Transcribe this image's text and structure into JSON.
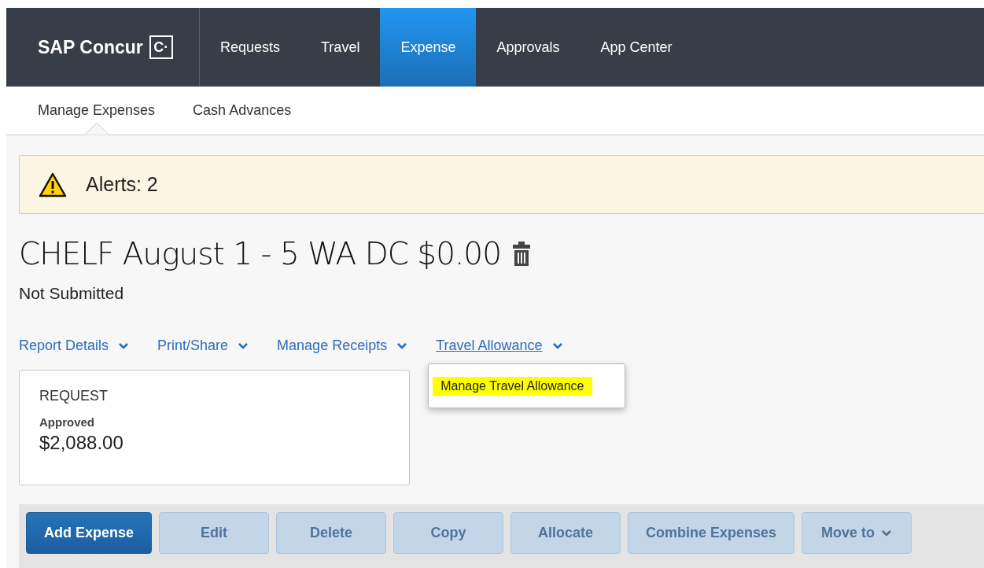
{
  "header": {
    "logo": "SAP Concur",
    "logo_mark": "C·",
    "tabs": [
      {
        "label": "Requests",
        "selected": false
      },
      {
        "label": "Travel",
        "selected": false
      },
      {
        "label": "Expense",
        "selected": true
      },
      {
        "label": "Approvals",
        "selected": false
      },
      {
        "label": "App Center",
        "selected": false
      }
    ]
  },
  "subnav": [
    {
      "label": "Manage Expenses",
      "selected": true
    },
    {
      "label": "Cash Advances",
      "selected": false
    }
  ],
  "alert": {
    "text": "Alerts: 2"
  },
  "report": {
    "title": "CHELF August 1 - 5 WA DC $0.00",
    "status": "Not Submitted"
  },
  "menus": [
    {
      "label": "Report Details",
      "expanded": false
    },
    {
      "label": "Print/Share",
      "expanded": false
    },
    {
      "label": "Manage Receipts",
      "expanded": false
    },
    {
      "label": "Travel Allowance",
      "expanded": true,
      "items": [
        {
          "label": "Manage Travel Allowance",
          "highlighted": true
        }
      ]
    }
  ],
  "request_card": {
    "heading": "REQUEST",
    "status": "Approved",
    "amount": "$2,088.00"
  },
  "toolbar": [
    {
      "label": "Add Expense",
      "disabled": false
    },
    {
      "label": "Edit",
      "disabled": true
    },
    {
      "label": "Delete",
      "disabled": true
    },
    {
      "label": "Copy",
      "disabled": true
    },
    {
      "label": "Allocate",
      "disabled": true
    },
    {
      "label": "Combine Expenses",
      "disabled": true
    },
    {
      "label": "Move to",
      "disabled": true,
      "kind": "dropdown"
    }
  ]
}
